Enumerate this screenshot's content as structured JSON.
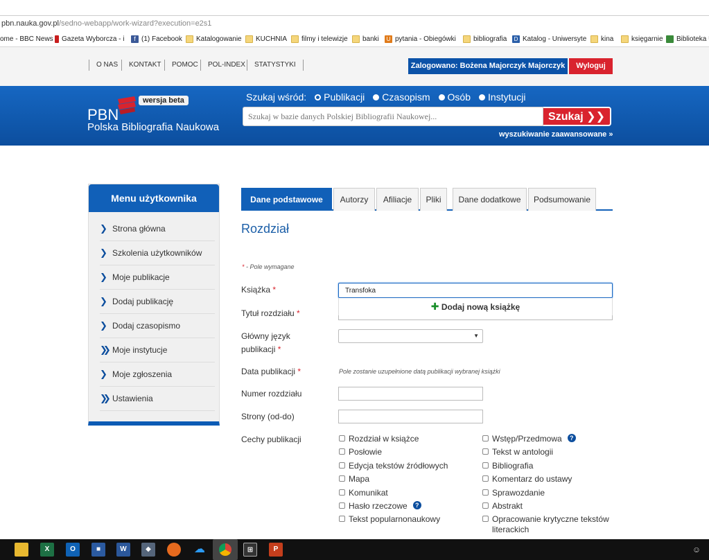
{
  "browser": {
    "url_host": "pbn.nauka.gov.pl",
    "url_path": "/sedno-webapp/work-wizard?execution=e2s1",
    "bookmarks": [
      {
        "label": "ome - BBC News",
        "icon": "none"
      },
      {
        "label": "Gazeta Wyborcza - i",
        "icon": "red-square-icon"
      },
      {
        "label": "(1) Facebook",
        "icon": "facebook-icon"
      },
      {
        "label": "Katalogowanie",
        "icon": "folder-icon"
      },
      {
        "label": "KUCHNIA",
        "icon": "folder-icon"
      },
      {
        "label": "filmy i telewizje",
        "icon": "folder-icon"
      },
      {
        "label": "banki",
        "icon": "folder-icon"
      },
      {
        "label": "pytania - Obiegówki",
        "icon": "u-icon"
      },
      {
        "label": "bibliografia",
        "icon": "folder-icon"
      },
      {
        "label": "Katalog - Uniwersyte",
        "icon": "d-icon"
      },
      {
        "label": "kina",
        "icon": "folder-icon"
      },
      {
        "label": "księgarnie",
        "icon": "folder-icon"
      },
      {
        "label": "Biblioteka Ur",
        "icon": "library-icon"
      }
    ]
  },
  "topnav": {
    "items": [
      "O NAS",
      "KONTAKT",
      "POMOC",
      "POL-INDEX",
      "STATYSTYKI"
    ],
    "logged_in": "Zalogowano: Bożena Majorczyk Majorczyk",
    "logout": "Wyloguj"
  },
  "header": {
    "logo_short": "PBN",
    "logo_full": "Polska Bibliografia Naukowa",
    "beta": "wersja beta",
    "search_in": "Szukaj wśród:",
    "search_options": [
      "Publikacji",
      "Czasopism",
      "Osób",
      "Instytucji"
    ],
    "search_placeholder": "Szukaj w bazie danych Polskiej Bibliografii Naukowej...",
    "search_button": "Szukaj",
    "advanced": "wyszukiwanie zaawansowane »"
  },
  "sidebar": {
    "title": "Menu użytkownika",
    "items": [
      {
        "label": "Strona główna",
        "icon": "chevron-right-icon"
      },
      {
        "label": "Szkolenia użytkowników",
        "icon": "chevron-right-icon"
      },
      {
        "label": "Moje publikacje",
        "icon": "chevron-right-icon"
      },
      {
        "label": "Dodaj publikację",
        "icon": "chevron-right-icon"
      },
      {
        "label": "Dodaj czasopismo",
        "icon": "chevron-right-icon"
      },
      {
        "label": "Moje instytucje",
        "icon": "double-chevron-right-icon"
      },
      {
        "label": "Moje zgłoszenia",
        "icon": "chevron-right-icon"
      },
      {
        "label": "Ustawienia",
        "icon": "double-chevron-right-icon"
      }
    ]
  },
  "tabs": [
    "Dane podstawowe",
    "Autorzy",
    "Afiliacje",
    "Pliki",
    "Dane dodatkowe",
    "Podsumowanie"
  ],
  "form": {
    "title": "Rozdział",
    "required_note": "- Pole wymagane",
    "book_label": "Książka",
    "book_value": "Transfoka",
    "add_book": "Dodaj nową książkę",
    "chapter_title_label": "Tytuł rozdziału",
    "language_label_1": "Główny język",
    "language_label_2": "publikacji",
    "date_label": "Data publikacji",
    "date_note": "Pole zostanie uzupełnione datą publikacji wybranej książki",
    "chapter_number_label": "Numer rozdziału",
    "pages_label": "Strony (od-do)",
    "features_label": "Cechy publikacji",
    "features_left": [
      "Rozdział w książce",
      "Posłowie",
      "Edycja tekstów źródłowych",
      "Mapa",
      "Komunikat",
      "Hasło rzeczowe",
      "Tekst popularnonaukowy"
    ],
    "features_right": [
      "Wstęp/Przedmowa",
      "Tekst w antologii",
      "Bibliografia",
      "Komentarz do ustawy",
      "Sprawozdanie",
      "Abstrakt",
      "Opracowanie krytyczne tekstów literackich"
    ]
  },
  "colors": {
    "brand_blue": "#1160b8",
    "accent_red": "#d9232e"
  },
  "taskbar": {
    "apps": [
      "file-explorer-icon",
      "excel-icon",
      "outlook-icon",
      "save-icon",
      "word-icon",
      "network-icon",
      "firefox-icon",
      "onedrive-icon",
      "chrome-icon",
      "calculator-icon",
      "powerpoint-icon"
    ]
  }
}
